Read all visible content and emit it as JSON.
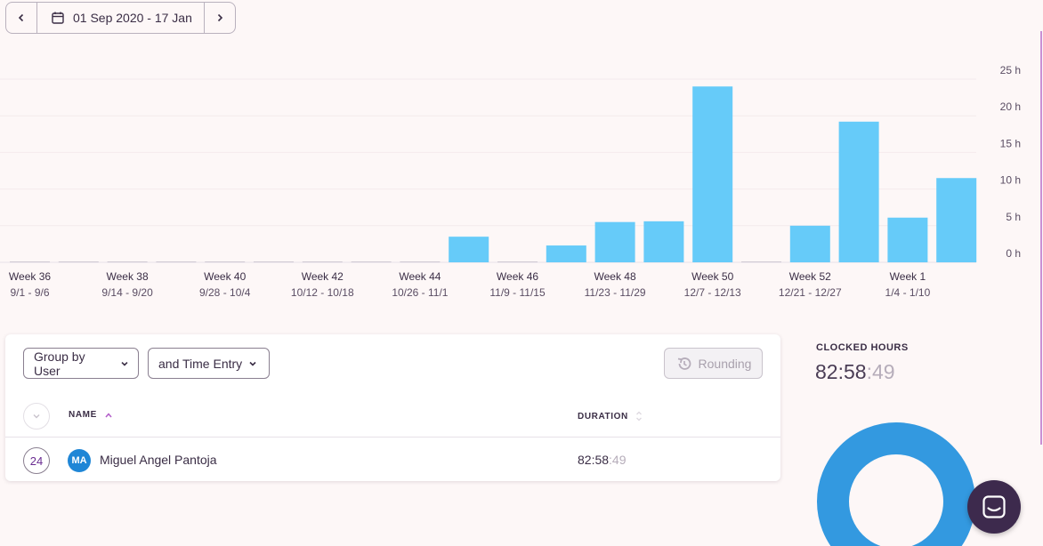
{
  "date_range": {
    "label": "01 Sep 2020 - 17 Jan",
    "prev_icon": "chevron-left-icon",
    "next_icon": "chevron-right-icon",
    "calendar_icon": "calendar-icon"
  },
  "chart_data": {
    "type": "bar",
    "unit": "h",
    "y_ticks": [
      "25 h",
      "20 h",
      "15 h",
      "10 h",
      "5 h",
      "0 h"
    ],
    "ylim": [
      0,
      25
    ],
    "grid": true,
    "bar_color": "#66cbf9",
    "values": [
      0,
      0,
      0,
      0,
      0,
      0,
      0,
      0,
      0,
      3.5,
      0,
      2.3,
      5.5,
      5.6,
      24,
      0,
      5,
      19.2,
      6.1,
      11.5
    ],
    "labels": [
      {
        "week": "Week 36",
        "range": "9/1 - 9/6"
      },
      {
        "week": "Week 38",
        "range": "9/14 - 9/20"
      },
      {
        "week": "Week 40",
        "range": "9/28 - 10/4"
      },
      {
        "week": "Week 42",
        "range": "10/12 - 10/18"
      },
      {
        "week": "Week 44",
        "range": "10/26 - 11/1"
      },
      {
        "week": "Week 46",
        "range": "11/9 - 11/15"
      },
      {
        "week": "Week 48",
        "range": "11/23 - 11/29"
      },
      {
        "week": "Week 50",
        "range": "12/7 - 12/13"
      },
      {
        "week": "Week 52",
        "range": "12/21 - 12/27"
      },
      {
        "week": "Week 1",
        "range": "1/4 - 1/10"
      }
    ]
  },
  "toolbar": {
    "group_by_label": "Group by User",
    "then_by_label": "and Time Entry",
    "rounding_label": "Rounding"
  },
  "table": {
    "columns": {
      "name": "NAME",
      "duration": "DURATION"
    },
    "rows": [
      {
        "count": "24",
        "initials": "MA",
        "name": "Miguel Angel Pantoja",
        "duration_main": "82:58",
        "duration_secs": ":49"
      }
    ]
  },
  "summary": {
    "label": "CLOCKED HOURS",
    "value_main": "82:58",
    "value_secs": ":49",
    "donut_color": "#3399e0"
  },
  "chat": {
    "icon": "chat-icon"
  }
}
